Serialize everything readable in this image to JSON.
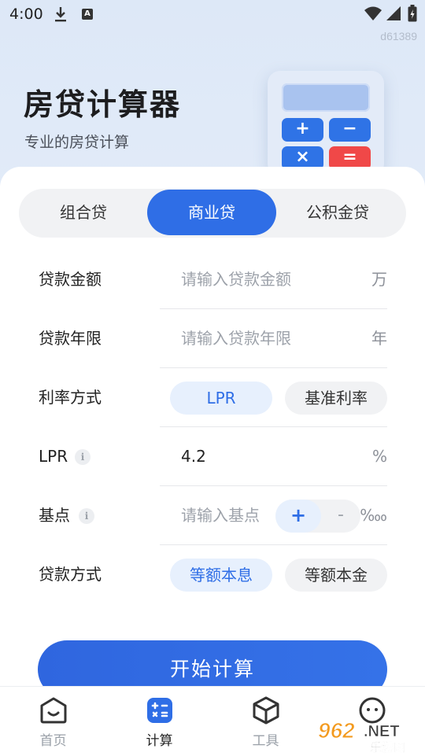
{
  "status_bar": {
    "time": "4:00",
    "a_badge": "A"
  },
  "watermark": "d61389",
  "hero": {
    "title": "房贷计算器",
    "subtitle": "专业的房贷计算"
  },
  "illustration_keys": {
    "plus": "+",
    "minus": "−",
    "times": "×",
    "equals": "="
  },
  "tabs": [
    {
      "label": "组合贷",
      "active": false
    },
    {
      "label": "商业贷",
      "active": true
    },
    {
      "label": "公积金贷",
      "active": false
    }
  ],
  "form": {
    "loan_amount": {
      "label": "贷款金额",
      "placeholder": "请输入贷款金额",
      "unit": "万"
    },
    "loan_term": {
      "label": "贷款年限",
      "placeholder": "请输入贷款年限",
      "unit": "年"
    },
    "rate_mode": {
      "label": "利率方式",
      "options": [
        "LPR",
        "基准利率"
      ],
      "selected": "LPR"
    },
    "lpr": {
      "label": "LPR",
      "value": "4.2",
      "unit": "%"
    },
    "basis_point": {
      "label": "基点",
      "placeholder": "请输入基点",
      "plus": "+",
      "minus": "-",
      "unit": "‱"
    },
    "repayment": {
      "label": "贷款方式",
      "options": [
        "等额本息",
        "等额本金"
      ],
      "selected": "等额本息"
    }
  },
  "info_glyph": "i",
  "calculate_button": "开始计算",
  "bottom_nav": [
    {
      "label": "首页",
      "icon": "home-face-icon",
      "active": false
    },
    {
      "label": "计算",
      "icon": "calculator-icon",
      "active": true
    },
    {
      "label": "工具",
      "icon": "cube-icon",
      "active": false
    },
    {
      "label": "",
      "icon": "chat-face-icon",
      "active": false
    }
  ],
  "watermark_logo": {
    "number": "962",
    "suffix": ".NET",
    "site": "乐游网"
  },
  "colors": {
    "primary": "#2f6ee6",
    "danger": "#f04848",
    "light_primary": "#e7f0fd",
    "neutral_pill": "#f1f2f4"
  }
}
